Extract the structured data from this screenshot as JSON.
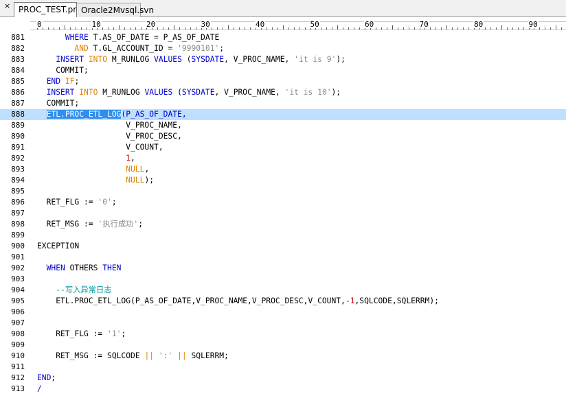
{
  "tabs": [
    {
      "label": "PROC_TEST.prc",
      "active": true
    },
    {
      "label": "Oracle2Mvsql.svn",
      "active": false
    }
  ],
  "close_glyph": "×",
  "ruler": {
    "labels": [
      "0",
      "10",
      "20",
      "30",
      "40",
      "50",
      "60",
      "70",
      "80",
      "90"
    ]
  },
  "colors": {
    "keyword": "#0000cc",
    "keyword_orange": "#e08000",
    "string": "#8a8a8a",
    "number": "#cc0000",
    "comment": "#009999",
    "current_line": "#bfdfff",
    "selection": "#2e8ff0"
  },
  "lines": [
    {
      "n": "881",
      "parts": [
        [
          "      ",
          ""
        ],
        [
          "WHERE",
          "kw"
        ],
        [
          " T.AS_OF_DATE = P_AS_OF_DATE",
          ""
        ]
      ]
    },
    {
      "n": "882",
      "parts": [
        [
          "        ",
          ""
        ],
        [
          "AND",
          "kw2"
        ],
        [
          " T.GL_ACCOUNT_ID = ",
          ""
        ],
        [
          "'9990101'",
          "str"
        ],
        [
          ";",
          ""
        ]
      ]
    },
    {
      "n": "883",
      "parts": [
        [
          "    ",
          ""
        ],
        [
          "INSERT",
          "kw"
        ],
        [
          " ",
          ""
        ],
        [
          "INTO",
          "kw2"
        ],
        [
          " M_RUNLOG ",
          ""
        ],
        [
          "VALUES",
          "kw"
        ],
        [
          " (",
          ""
        ],
        [
          "SYSDATE",
          "kw"
        ],
        [
          ", V_PROC_NAME, ",
          ""
        ],
        [
          "'it is 9'",
          "str"
        ],
        [
          ");",
          ""
        ]
      ]
    },
    {
      "n": "884",
      "parts": [
        [
          "    COMMIT;",
          ""
        ]
      ]
    },
    {
      "n": "885",
      "parts": [
        [
          "  ",
          ""
        ],
        [
          "END",
          "kw"
        ],
        [
          " ",
          ""
        ],
        [
          "IF",
          "kw2"
        ],
        [
          ";",
          ""
        ]
      ]
    },
    {
      "n": "886",
      "parts": [
        [
          "  ",
          ""
        ],
        [
          "INSERT",
          "kw"
        ],
        [
          " ",
          ""
        ],
        [
          "INTO",
          "kw2"
        ],
        [
          " M_RUNLOG ",
          ""
        ],
        [
          "VALUES",
          "kw"
        ],
        [
          " (",
          ""
        ],
        [
          "SYSDATE",
          "kw"
        ],
        [
          ", V_PROC_NAME, ",
          ""
        ],
        [
          "'it is 10'",
          "str"
        ],
        [
          ");",
          ""
        ]
      ]
    },
    {
      "n": "887",
      "parts": [
        [
          "  COMMIT;",
          ""
        ]
      ]
    },
    {
      "n": "888",
      "current": true,
      "parts": [
        [
          "  ",
          ""
        ],
        [
          "ETL.PROC_ETL_LOG",
          "sel"
        ],
        [
          "(P_AS_OF_DATE,",
          "selnext"
        ]
      ]
    },
    {
      "n": "889",
      "parts": [
        [
          "                   V_PROC_NAME,",
          ""
        ]
      ]
    },
    {
      "n": "890",
      "parts": [
        [
          "                   V_PROC_DESC,",
          ""
        ]
      ]
    },
    {
      "n": "891",
      "parts": [
        [
          "                   V_COUNT,",
          ""
        ]
      ]
    },
    {
      "n": "892",
      "parts": [
        [
          "                   ",
          ""
        ],
        [
          "1",
          "num1"
        ],
        [
          ",",
          ""
        ]
      ]
    },
    {
      "n": "893",
      "parts": [
        [
          "                   ",
          ""
        ],
        [
          "NULL",
          "kw2"
        ],
        [
          ",",
          ""
        ]
      ]
    },
    {
      "n": "894",
      "parts": [
        [
          "                   ",
          ""
        ],
        [
          "NULL",
          "kw2"
        ],
        [
          ");",
          ""
        ]
      ]
    },
    {
      "n": "895",
      "parts": []
    },
    {
      "n": "896",
      "parts": [
        [
          "  RET_FLG := ",
          ""
        ],
        [
          "'0'",
          "str"
        ],
        [
          ";",
          ""
        ]
      ]
    },
    {
      "n": "897",
      "parts": []
    },
    {
      "n": "898",
      "parts": [
        [
          "  RET_MSG := ",
          ""
        ],
        [
          "'执行成功'",
          "str"
        ],
        [
          ";",
          ""
        ]
      ]
    },
    {
      "n": "899",
      "parts": []
    },
    {
      "n": "900",
      "parts": [
        [
          "EXCEPTION",
          ""
        ]
      ]
    },
    {
      "n": "901",
      "parts": []
    },
    {
      "n": "902",
      "parts": [
        [
          "  ",
          ""
        ],
        [
          "WHEN",
          "kw"
        ],
        [
          " OTHERS ",
          ""
        ],
        [
          "THEN",
          "kw"
        ]
      ]
    },
    {
      "n": "903",
      "parts": []
    },
    {
      "n": "904",
      "parts": [
        [
          "    ",
          ""
        ],
        [
          "--写入异常日志",
          "cm"
        ]
      ]
    },
    {
      "n": "905",
      "parts": [
        [
          "    ETL.PROC_ETL_LOG(P_AS_OF_DATE,V_PROC_NAME,V_PROC_DESC,V_COUNT,",
          ""
        ],
        [
          "-1",
          "num1"
        ],
        [
          ",SQLCODE,SQLERRM);",
          ""
        ]
      ]
    },
    {
      "n": "906",
      "parts": []
    },
    {
      "n": "907",
      "parts": []
    },
    {
      "n": "908",
      "parts": [
        [
          "    RET_FLG := ",
          ""
        ],
        [
          "'1'",
          "str"
        ],
        [
          ";",
          ""
        ]
      ]
    },
    {
      "n": "909",
      "parts": []
    },
    {
      "n": "910",
      "parts": [
        [
          "    RET_MSG := SQLCODE ",
          ""
        ],
        [
          "||",
          "kw2"
        ],
        [
          " ",
          ""
        ],
        [
          "':'",
          "str"
        ],
        [
          " ",
          ""
        ],
        [
          "||",
          "kw2"
        ],
        [
          " SQLERRM;",
          ""
        ]
      ]
    },
    {
      "n": "911",
      "parts": []
    },
    {
      "n": "912",
      "parts": [
        [
          "END",
          "kw"
        ],
        [
          ";",
          ""
        ]
      ]
    },
    {
      "n": "913",
      "parts": [
        [
          "/",
          "kw"
        ]
      ]
    }
  ]
}
